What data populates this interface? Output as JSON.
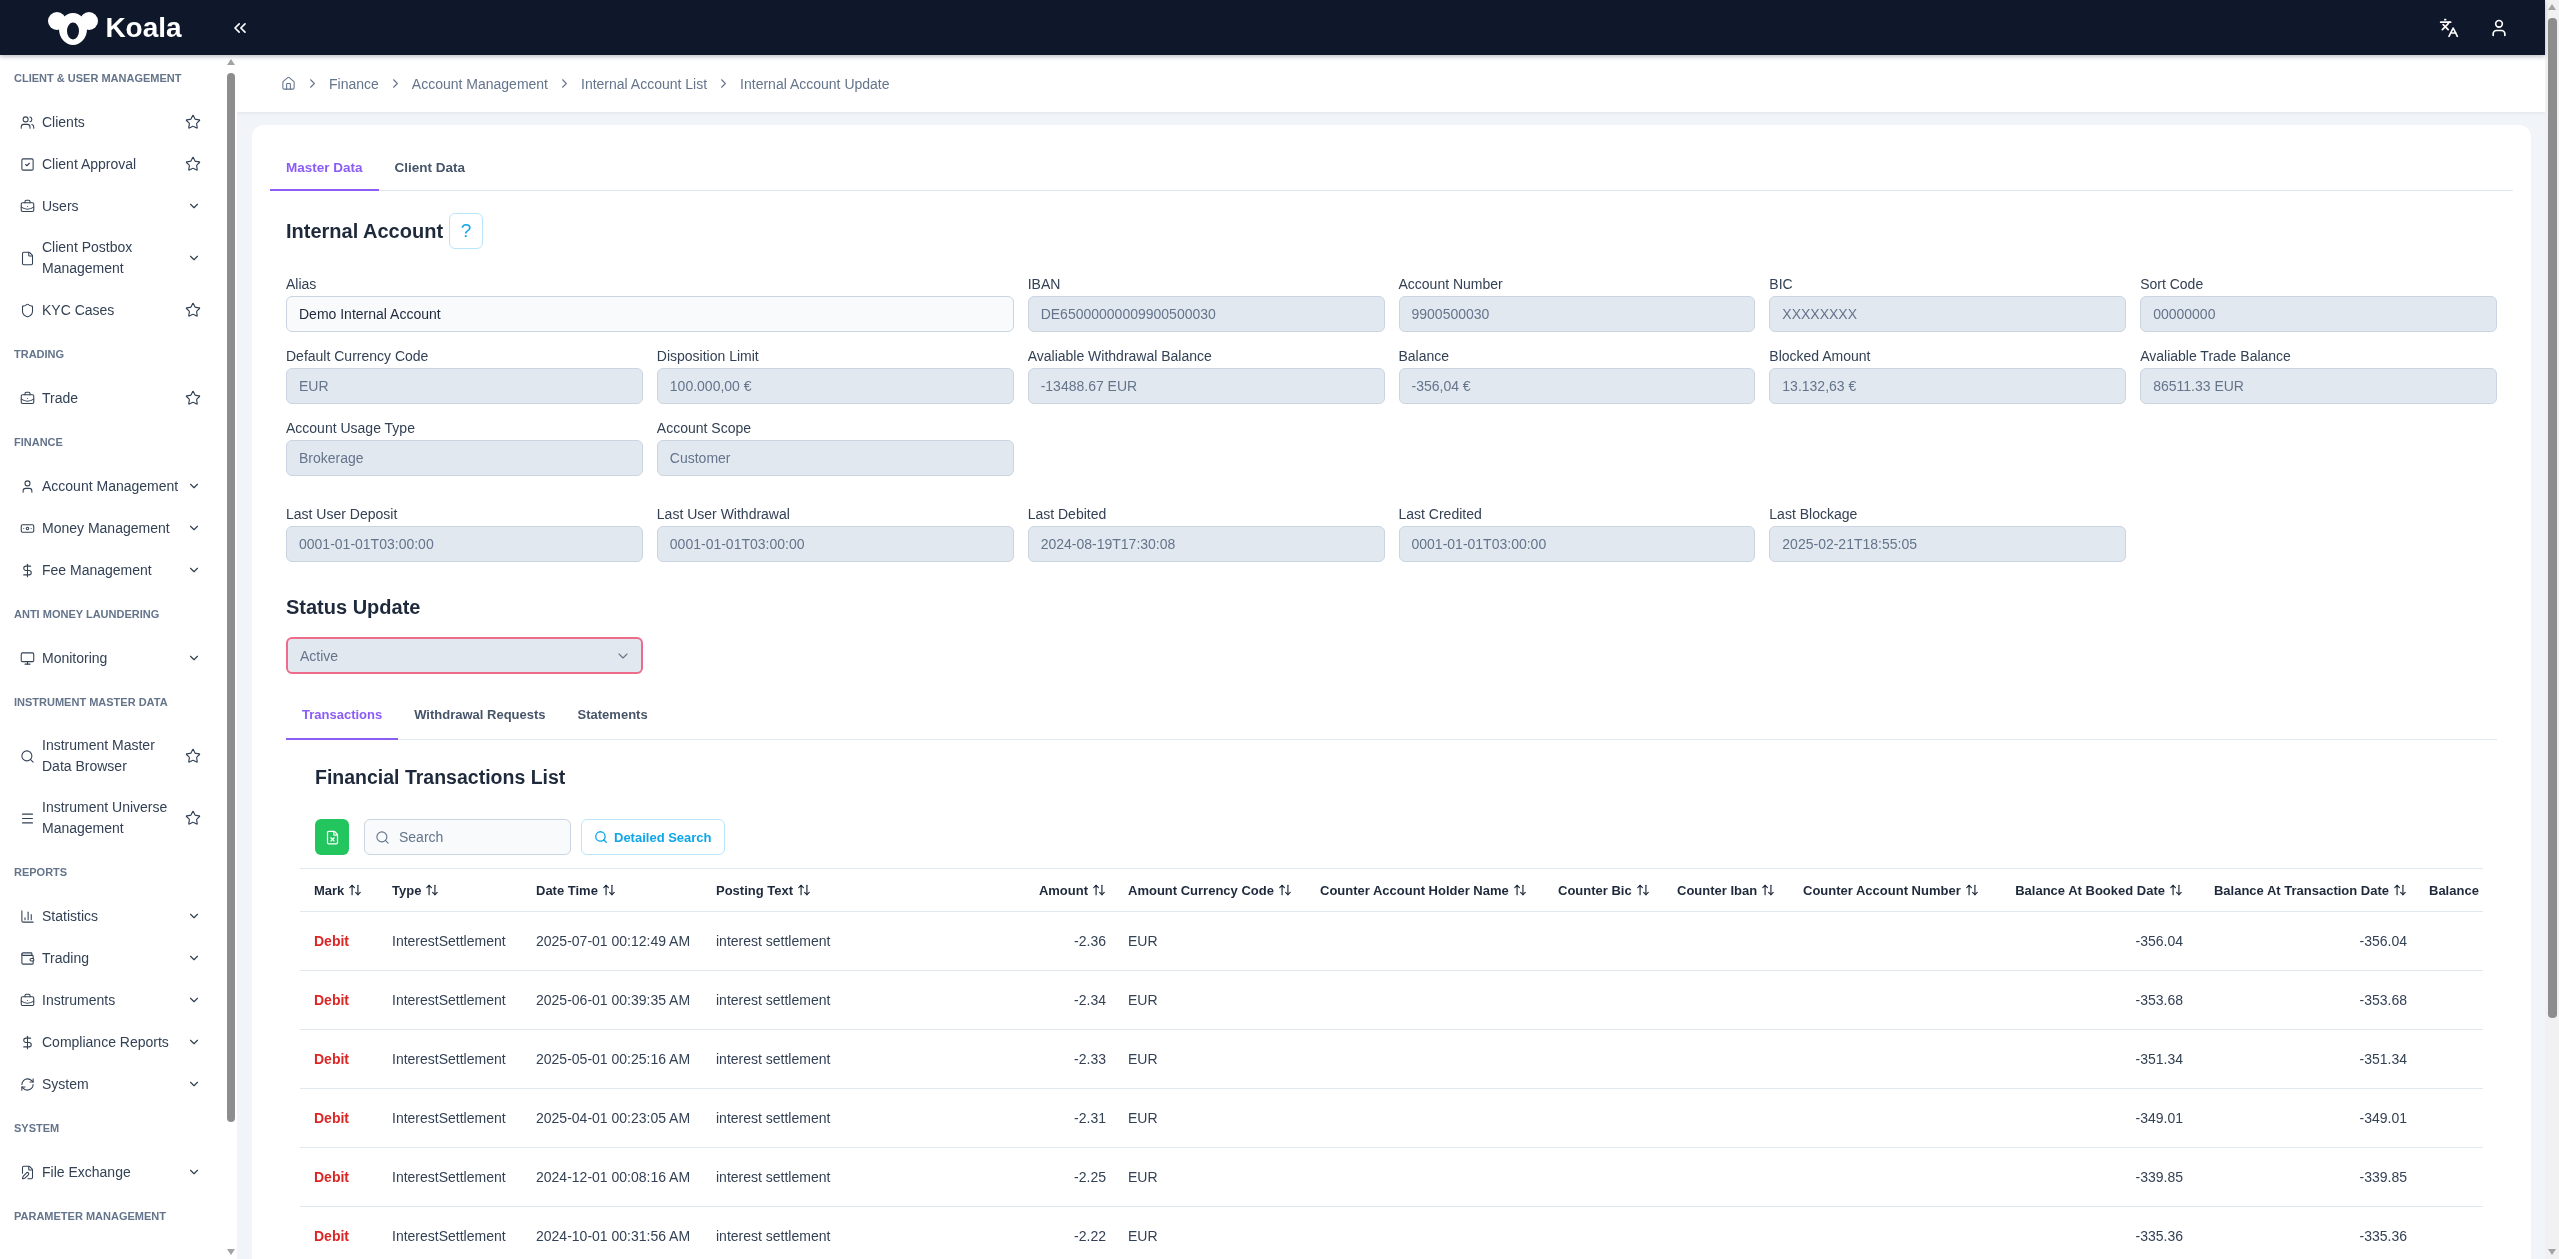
{
  "top_bar": {
    "logo_text": "Koala"
  },
  "sidebar": {
    "sections": [
      {
        "title": "CLIENT & USER MANAGEMENT",
        "items": [
          {
            "label": "Clients",
            "kind": "page",
            "favorite": false
          },
          {
            "label": "Client Approval",
            "kind": "page",
            "favorite": false
          },
          {
            "label": "Users",
            "kind": "group",
            "expanded": false
          },
          {
            "label": "Client Postbox Management",
            "kind": "group",
            "expanded": false
          },
          {
            "label": "KYC Cases",
            "kind": "page",
            "favorite": false
          }
        ]
      },
      {
        "title": "TRADING",
        "items": [
          {
            "label": "Trade",
            "kind": "page",
            "favorite": false
          }
        ]
      },
      {
        "title": "FINANCE",
        "items": [
          {
            "label": "Account Management",
            "kind": "group",
            "expanded": false
          },
          {
            "label": "Money Management",
            "kind": "group",
            "expanded": false
          },
          {
            "label": "Fee Management",
            "kind": "group",
            "expanded": false
          }
        ]
      },
      {
        "title": "ANTI MONEY LAUNDERING",
        "items": [
          {
            "label": "Monitoring",
            "kind": "group",
            "expanded": false
          }
        ]
      },
      {
        "title": "INSTRUMENT MASTER DATA",
        "items": [
          {
            "label": "Instrument Master Data Browser",
            "kind": "page",
            "favorite": false
          },
          {
            "label": "Instrument Universe Management",
            "kind": "page",
            "favorite": false
          }
        ]
      },
      {
        "title": "REPORTS",
        "items": [
          {
            "label": "Statistics",
            "kind": "group",
            "expanded": false
          },
          {
            "label": "Trading",
            "kind": "group",
            "expanded": false
          },
          {
            "label": "Instruments",
            "kind": "group",
            "expanded": false
          },
          {
            "label": "Compliance Reports",
            "kind": "group",
            "expanded": false
          },
          {
            "label": "System",
            "kind": "group",
            "expanded": false
          }
        ]
      },
      {
        "title": "SYSTEM",
        "items": [
          {
            "label": "File Exchange",
            "kind": "group",
            "expanded": false
          }
        ]
      },
      {
        "title": "PARAMETER MANAGEMENT"
      }
    ]
  },
  "breadcrumb": [
    "Finance",
    "Account Management",
    "Internal Account List",
    "Internal Account Update"
  ],
  "tabs": [
    {
      "label": "Master Data",
      "selected": true
    },
    {
      "label": "Client Data",
      "selected": false
    }
  ],
  "account": {
    "title": "Internal Account",
    "help": "?",
    "field_groups": [
      [
        {
          "label": "Alias",
          "value": "Demo Internal Account",
          "disabled": false
        },
        {
          "label": "IBAN",
          "value": "DE65000000009900500030",
          "disabled": true
        },
        {
          "label": "Account Number",
          "value": "9900500030",
          "disabled": true
        },
        {
          "label": "BIC",
          "value": "XXXXXXXX",
          "disabled": true
        },
        {
          "label": "Sort Code",
          "value": "00000000",
          "disabled": true
        },
        {
          "label": "Default Currency Code",
          "value": "EUR",
          "disabled": true
        },
        {
          "label": "Disposition Limit",
          "value": "100.000,00 €",
          "disabled": true
        },
        {
          "label": "Avaliable Withdrawal Balance",
          "value": "-13488.67 EUR",
          "disabled": true
        },
        {
          "label": "Balance",
          "value": "-356,04 €",
          "disabled": true
        },
        {
          "label": "Blocked Amount",
          "value": "13.132,63 €",
          "disabled": true
        },
        {
          "label": "Avaliable Trade Balance",
          "value": "86511.33 EUR",
          "disabled": true
        },
        {
          "label": "Account Usage Type",
          "value": "Brokerage",
          "disabled": true
        },
        {
          "label": "Account Scope",
          "value": "Customer",
          "disabled": true
        }
      ],
      [
        {
          "label": "Last User Deposit",
          "value": "0001-01-01T03:00:00",
          "disabled": true
        },
        {
          "label": "Last User Withdrawal",
          "value": "0001-01-01T03:00:00",
          "disabled": true
        },
        {
          "label": "Last Debited",
          "value": "2024-08-19T17:30:08",
          "disabled": true
        },
        {
          "label": "Last Credited",
          "value": "0001-01-01T03:00:00",
          "disabled": true
        },
        {
          "label": "Last Blockage",
          "value": "2025-02-21T18:55:05",
          "disabled": true
        }
      ]
    ]
  },
  "status_update": {
    "title": "Status Update",
    "select": {
      "value": "Active",
      "focused": true
    }
  },
  "sub_tabs": [
    {
      "label": "Transactions",
      "selected": true
    },
    {
      "label": "Withdrawal Requests",
      "selected": false
    },
    {
      "label": "Statements",
      "selected": false
    }
  ],
  "transactions": {
    "title": "Financial Transactions List",
    "search": {
      "placeholder": "Search"
    },
    "detailed_search": "Detailed Search",
    "table": {
      "columns": [
        {
          "label": "Mark",
          "sortable": true
        },
        {
          "label": "Type",
          "sortable": true
        },
        {
          "label": "Date Time",
          "sortable": true
        },
        {
          "label": "Posting Text",
          "sortable": true
        },
        {
          "label": "Amount",
          "sortable": true
        },
        {
          "label": "Amount Currency Code",
          "sortable": true
        },
        {
          "label": "Counter Account Holder Name",
          "sortable": true
        },
        {
          "label": "Counter Bic",
          "sortable": true
        },
        {
          "label": "Counter Iban",
          "sortable": true
        },
        {
          "label": "Counter Account Number",
          "sortable": true
        },
        {
          "label": "Balance At Booked Date",
          "sortable": true
        },
        {
          "label": "Balance At Transaction Date",
          "sortable": true
        },
        {
          "label": "Balance"
        }
      ],
      "rows": [
        {
          "mark": "Debit",
          "type": "InterestSettlement",
          "date_time": "2025-07-01 00:12:49 AM",
          "posting_text": "interest settlement",
          "amount": "-2.36",
          "amount_currency_code": "EUR",
          "balance_at_booked_date": "-356.04",
          "balance_at_transaction_date": "-356.04"
        },
        {
          "mark": "Debit",
          "type": "InterestSettlement",
          "date_time": "2025-06-01 00:39:35 AM",
          "posting_text": "interest settlement",
          "amount": "-2.34",
          "amount_currency_code": "EUR",
          "balance_at_booked_date": "-353.68",
          "balance_at_transaction_date": "-353.68"
        },
        {
          "mark": "Debit",
          "type": "InterestSettlement",
          "date_time": "2025-05-01 00:25:16 AM",
          "posting_text": "interest settlement",
          "amount": "-2.33",
          "amount_currency_code": "EUR",
          "balance_at_booked_date": "-351.34",
          "balance_at_transaction_date": "-351.34"
        },
        {
          "mark": "Debit",
          "type": "InterestSettlement",
          "date_time": "2025-04-01 00:23:05 AM",
          "posting_text": "interest settlement",
          "amount": "-2.31",
          "amount_currency_code": "EUR",
          "balance_at_booked_date": "-349.01",
          "balance_at_transaction_date": "-349.01"
        },
        {
          "mark": "Debit",
          "type": "InterestSettlement",
          "date_time": "2024-12-01 00:08:16 AM",
          "posting_text": "interest settlement",
          "amount": "-2.25",
          "amount_currency_code": "EUR",
          "balance_at_booked_date": "-339.85",
          "balance_at_transaction_date": "-339.85"
        },
        {
          "mark": "Debit",
          "type": "InterestSettlement",
          "date_time": "2024-10-01 00:31:56 AM",
          "posting_text": "interest settlement",
          "amount": "-2.22",
          "amount_currency_code": "EUR",
          "balance_at_booked_date": "-335.36",
          "balance_at_transaction_date": "-335.36"
        }
      ]
    }
  }
}
